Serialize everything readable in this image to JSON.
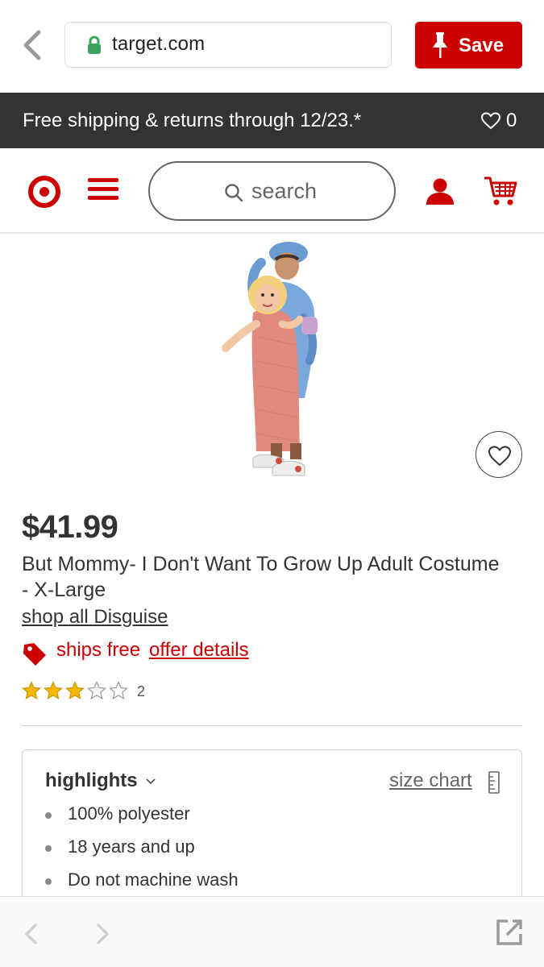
{
  "browser": {
    "url": "target.com",
    "save_label": "Save"
  },
  "promo": {
    "text": "Free shipping & returns through 12/23.*",
    "favorites_count": "0"
  },
  "nav": {
    "search_placeholder": "search"
  },
  "product": {
    "price": "$41.99",
    "title": "But Mommy- I Don't Want To Grow Up Adult Costume - X-Large",
    "shop_all": "shop all Disguise",
    "ships_free": "ships free",
    "offer_details": "offer details",
    "rating": 3,
    "rating_max": 5,
    "review_count": "2"
  },
  "highlights": {
    "title": "highlights",
    "size_chart": "size chart",
    "items": [
      "100% polyester",
      "18 years and up",
      "Do not machine wash"
    ]
  },
  "colors": {
    "brand_red": "#cc0000",
    "banner_bg": "#333333",
    "star_gold": "#f5b800"
  },
  "icons": [
    "back-arrow-icon",
    "lock-icon",
    "pin-icon",
    "heart-icon",
    "target-logo",
    "menu-icon",
    "search-icon",
    "account-icon",
    "cart-icon",
    "tag-icon",
    "star-icon",
    "chevron-down-icon",
    "ruler-icon",
    "share-icon"
  ]
}
